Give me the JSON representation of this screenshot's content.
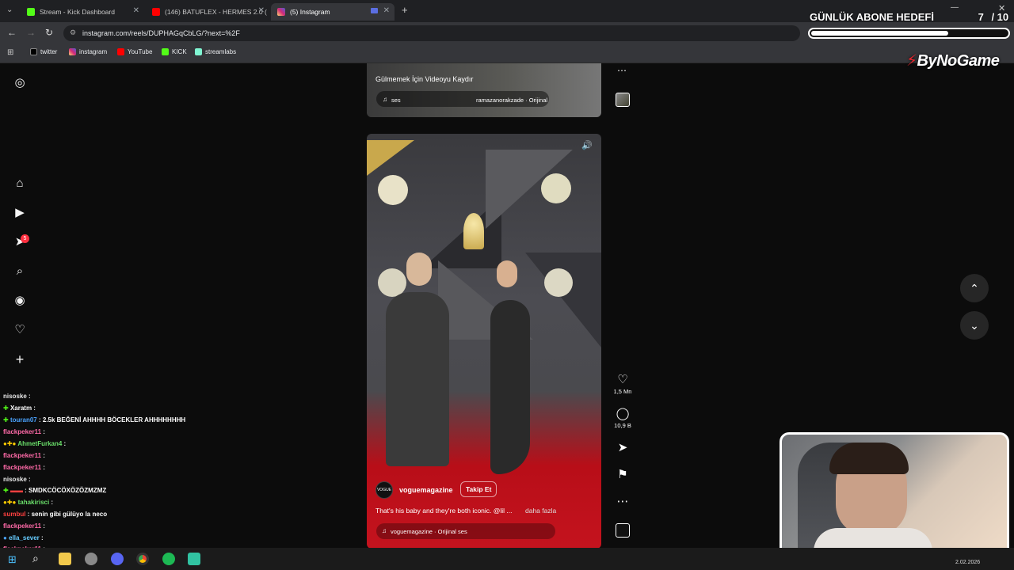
{
  "browser": {
    "tabs": [
      {
        "title": "Stream - Kick Dashboard",
        "color": "#53fc18"
      },
      {
        "title": "(146) BATUFLEX - HERMES 2.0 (",
        "color": "#ff0000"
      },
      {
        "title": "(5) Instagram",
        "color": "#e1306c"
      }
    ],
    "url": "instagram.com/reels/DUPHAGqCbLG/?next=%2F",
    "bookmarks": [
      {
        "label": "twitter",
        "icon": "x-icon"
      },
      {
        "label": "instagram",
        "icon": "instagram-icon"
      },
      {
        "label": "YouTube",
        "icon": "youtube-icon"
      },
      {
        "label": "KICK",
        "icon": "kick-icon"
      },
      {
        "label": "streamlabs",
        "icon": "streamlabs-icon"
      }
    ]
  },
  "instagram": {
    "notification_count": "5",
    "reel_prev": {
      "caption": "Gülmemek İçin Videoyu Kaydır",
      "audio": "ses",
      "author_audio": "ramazanorakzade · Orijinal"
    },
    "reel": {
      "username": "voguemagazine",
      "follow_label": "Takip Et",
      "caption": "That's his baby and they're both iconic. @lil ...",
      "more": "daha fazla",
      "audio": "voguemagazine · Orijinal ses",
      "likes": "1,5 Mn",
      "comments": "10,9 B",
      "avatar_text": "VOGUE"
    }
  },
  "chat": [
    {
      "user": "nisoske",
      "msg": "",
      "color": "#e8e8e8"
    },
    {
      "user": "Xaratm",
      "msg": "",
      "color": "#ffffff"
    },
    {
      "user": "touran07",
      "msg": "2.5k BEĞENİ AHHHH BÖCEKLER AHHHHHHHH",
      "color": "#4aa3ff"
    },
    {
      "user": "flackpeker11",
      "msg": "",
      "color": "#ff6aa8"
    },
    {
      "user": "AhmetFurkan4",
      "msg": "",
      "color": "#6adf6a"
    },
    {
      "user": "flackpeker11",
      "msg": "",
      "color": "#ff6aa8"
    },
    {
      "user": "flackpeker11",
      "msg": "",
      "color": "#ff6aa8"
    },
    {
      "user": "nisoske",
      "msg": "",
      "color": "#e8e8e8"
    },
    {
      "user": "",
      "msg": "SMDKCÖCÖXÖZÖZMZMZ",
      "color": "#ff4040"
    },
    {
      "user": "tahakirisci",
      "msg": "",
      "color": "#6adf6a"
    },
    {
      "user": "sumbul",
      "msg": "senin gibi gülüyo la neco",
      "color": "#ff4040"
    },
    {
      "user": "flackpeker11",
      "msg": "",
      "color": "#ff6aa8"
    },
    {
      "user": "ella_sever",
      "msg": "",
      "color": "#66ccff"
    },
    {
      "user": "flackpeker11",
      "msg": "",
      "color": "#ff6aa8"
    }
  ],
  "overlay": {
    "goal_title": "GÜNLÜK ABONE HEDEFİ",
    "goal_current": "7",
    "goal_total": "/ 10",
    "goal_progress": 0.7,
    "brand": "ByNoGame"
  },
  "taskbar": {
    "date": "2.02.2026"
  }
}
